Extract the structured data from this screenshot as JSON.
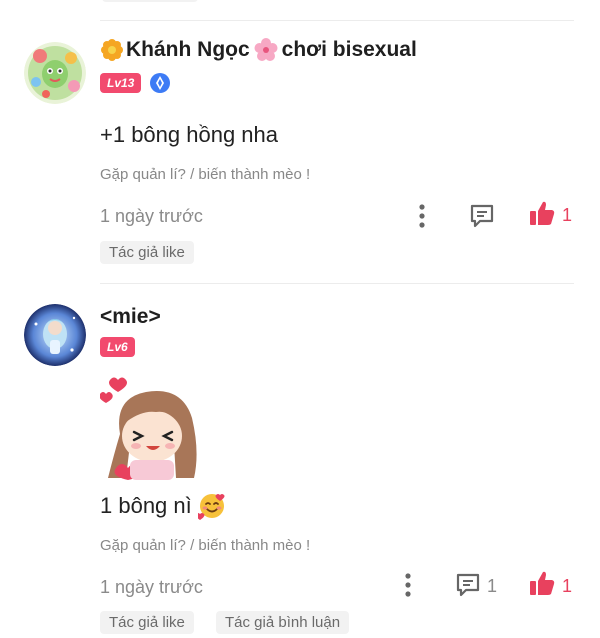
{
  "comments": [
    {
      "username": "Khánh Ngọc",
      "username_suffix": "chơi bisexual",
      "level": "Lv13",
      "text": "+1 bông hồng nha",
      "signature": "Gặp quản lí? / biến thành mèo !",
      "time": "1 ngày trước",
      "reply_count": "",
      "like_count": "1",
      "tags": [
        "Tác giả like"
      ]
    },
    {
      "username": "<mie>",
      "level": "Lv6",
      "text": "1 bông nì",
      "signature": "Gặp quản lí? / biến thành mèo !",
      "time": "1 ngày trước",
      "reply_count": "1",
      "like_count": "1",
      "tags": [
        "Tác giả like",
        "Tác giả bình luận"
      ]
    }
  ],
  "colors": {
    "accent": "#f24a6e",
    "like": "#e8415e",
    "muted": "#8a8a8a",
    "verify": "#3d7bf5"
  },
  "icons": [
    "flower-icon",
    "verified-icon",
    "more-icon",
    "reply-icon",
    "like-icon",
    "sticker-image",
    "emoji-icon"
  ]
}
